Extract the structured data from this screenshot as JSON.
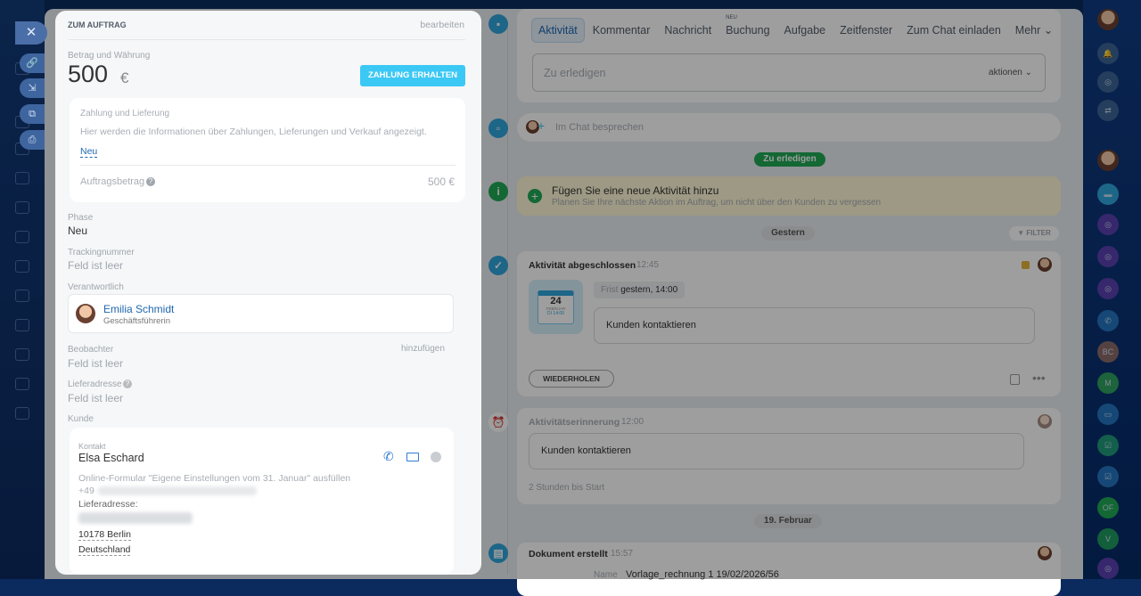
{
  "panel": {
    "title": "ZUM AUFTRAG",
    "edit": "bearbeiten",
    "amount_label": "Betrag und Währung",
    "amount": "500",
    "currency": "€",
    "pay_button": "ZAHLUNG ERHALTEN",
    "payment_box": {
      "title": "Zahlung und Lieferung",
      "info": "Hier werden die Informationen über Zahlungen, Lieferungen und Verkauf angezeigt.",
      "link": "Neu",
      "order_label": "Auftragsbetrag",
      "order_value": "500 €"
    },
    "phase_label": "Phase",
    "phase": "Neu",
    "tracking_label": "Trackingnummer",
    "tracking": "Feld ist leer",
    "responsible_label": "Verantwortlich",
    "responsible_name": "Emilia Schmidt",
    "responsible_role": "Geschäftsführerin",
    "observers_label": "Beobachter",
    "observers_add": "hinzufügen",
    "observers": "Feld ist leer",
    "address_label": "Lieferadresse",
    "address": "Feld ist leer",
    "customer_label": "Kunde",
    "contact": {
      "type": "Kontakt",
      "name": "Elsa Eschard",
      "source": "Online-Formular \"Eigene Einstellungen vom 31. Januar\" ausfüllen",
      "phone_prefix": "+49",
      "address_label": "Lieferadresse:",
      "city": "10178 Berlin",
      "country": "Deutschland"
    }
  },
  "timeline": {
    "tabs": [
      "Aktivität",
      "Kommentar",
      "Nachricht",
      "Buchung",
      "Aufgabe",
      "Zeitfenster",
      "Zum Chat einladen",
      "Mehr"
    ],
    "new_badge": "NEU",
    "todo_placeholder": "Zu erledigen",
    "actions": "aktionen",
    "chat_placeholder": "Im Chat besprechen",
    "todo_pill": "Zu erledigen",
    "add_title": "Fügen Sie eine neue Aktivität hinzu",
    "add_sub": "Planen Sie Ihre nächste Aktion im Auftrag, um nicht über den Kunden zu vergessen",
    "yesterday": "Gestern",
    "filter": "FILTER",
    "done": {
      "title": "Aktivität abgeschlossen",
      "time": "12:45",
      "cal_day": "24",
      "cal_month": "FEBRUAR",
      "cal_time": "DI 14:00",
      "deadline_label": "Frist",
      "deadline": "gestern, 14:00",
      "text": "Kunden kontaktieren",
      "repeat": "WIEDERHOLEN"
    },
    "reminder": {
      "title": "Aktivitätserinnerung",
      "time": "12:00",
      "text": "Kunden kontaktieren",
      "footer": "2 Stunden bis Start"
    },
    "date2": "19. Februar",
    "doc": {
      "title": "Dokument erstellt",
      "time": "15:57",
      "name_label": "Name",
      "name": "Vorlage_rechnung 1 19/02/2026/56"
    }
  },
  "rightbar": {
    "initials": [
      "BC",
      "M",
      "OF",
      "V"
    ]
  },
  "colors": {
    "accent": "#3bc8f5",
    "green": "#1fa855",
    "link": "#2067b0"
  }
}
